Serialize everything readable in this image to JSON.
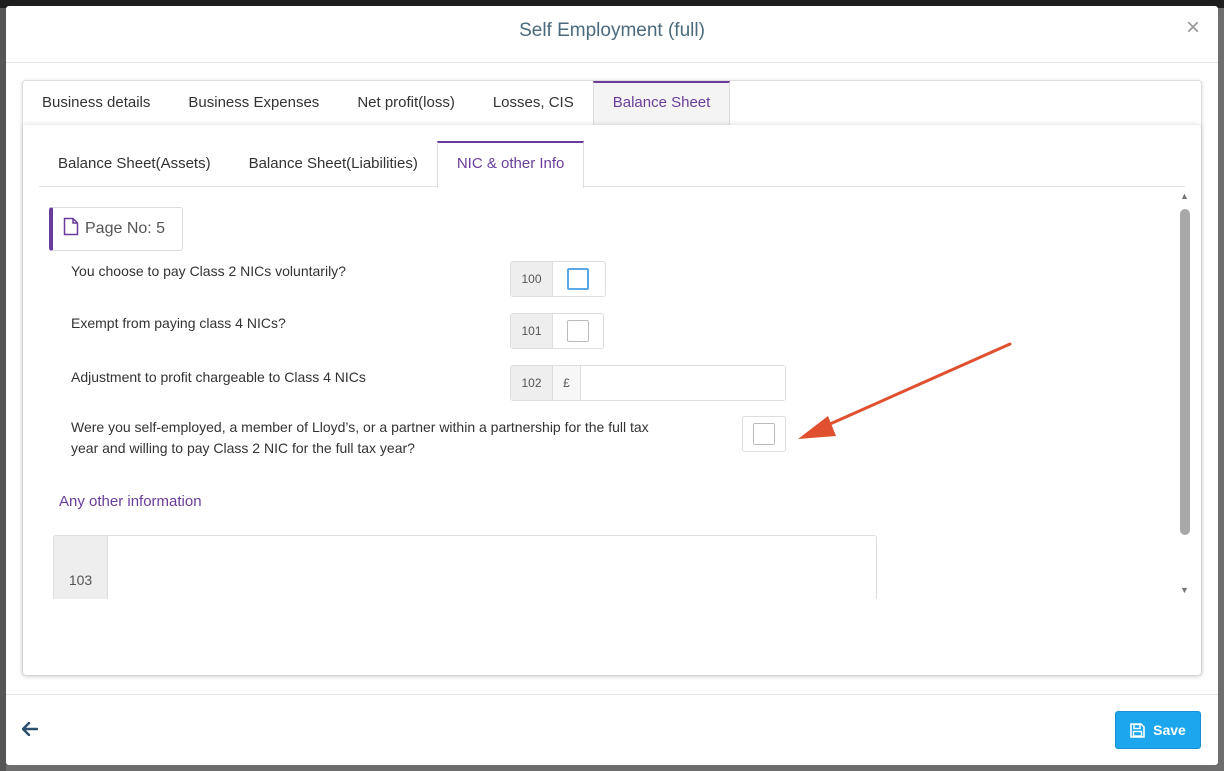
{
  "modal": {
    "title": "Self Employment (full)",
    "close_label": "×"
  },
  "main_tabs": [
    {
      "label": "Business details"
    },
    {
      "label": "Business Expenses"
    },
    {
      "label": "Net profit(loss)"
    },
    {
      "label": "Losses, CIS"
    },
    {
      "label": "Balance Sheet"
    }
  ],
  "sub_tabs": [
    {
      "label": "Balance Sheet(Assets)"
    },
    {
      "label": "Balance Sheet(Liabilities)"
    },
    {
      "label": "NIC & other Info"
    }
  ],
  "page_badge": {
    "label": "Page No: 5",
    "icon": "document-icon"
  },
  "questions": [
    {
      "text": "You choose to pay Class 2 NICs voluntarily?",
      "box": "100",
      "checked": false
    },
    {
      "text": "Exempt from paying class 4 NICs?",
      "box": "101",
      "checked": false
    },
    {
      "text": "Adjustment to profit chargeable to Class 4 NICs",
      "box": "102",
      "currency": "£",
      "value": ""
    },
    {
      "text": "Were you self-employed, a member of Lloyd’s, or a partner within a partnership for the full tax year and willing to pay Class 2 NIC for the full tax year?",
      "checked": false
    }
  ],
  "other_info": {
    "heading": "Any other information",
    "box": "103",
    "value": ""
  },
  "footer": {
    "save_label": "Save",
    "back_icon": "arrow-left-icon",
    "save_icon": "floppy-disk-icon"
  },
  "colors": {
    "accent": "#6a3d9a",
    "save_button": "#1ba6ee",
    "annotation_arrow": "#e0502f",
    "title": "#4a6a7e"
  }
}
